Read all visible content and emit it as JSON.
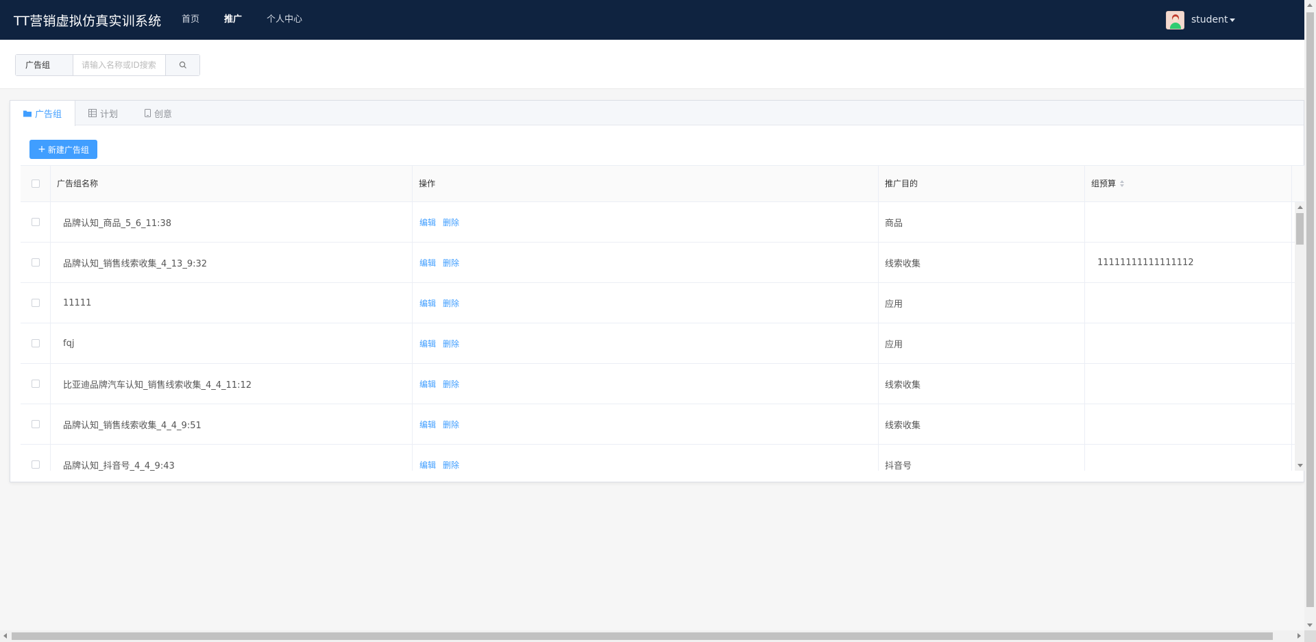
{
  "app": {
    "title": "TT营销虚拟仿真实训系统",
    "nav": [
      {
        "label": "首页",
        "active": false
      },
      {
        "label": "推广",
        "active": true
      },
      {
        "label": "个人中心",
        "active": false
      }
    ],
    "user": {
      "name": "student",
      "avatar_icon": "user-avatar-icon"
    }
  },
  "search": {
    "scope": "广告组",
    "placeholder": "请输入名称或ID搜索",
    "value": "",
    "button_icon": "search-icon"
  },
  "tabs": [
    {
      "label": "广告组",
      "icon": "folder-icon",
      "active": true
    },
    {
      "label": "计划",
      "icon": "table-icon",
      "active": false
    },
    {
      "label": "创意",
      "icon": "mobile-icon",
      "active": false
    }
  ],
  "toolbar": {
    "new_label": "新建广告组"
  },
  "table": {
    "columns": [
      "广告组名称",
      "操作",
      "推广目的",
      "组预算"
    ],
    "actions": {
      "edit": "编辑",
      "delete": "删除"
    },
    "rows": [
      {
        "name": "品牌认知_商品_5_6_11:38",
        "purpose": "商品",
        "budget": ""
      },
      {
        "name": "品牌认知_销售线索收集_4_13_9:32",
        "purpose": "线索收集",
        "budget": "11111111111111112"
      },
      {
        "name": "11111",
        "purpose": "应用",
        "budget": ""
      },
      {
        "name": "fqj",
        "purpose": "应用",
        "budget": ""
      },
      {
        "name": "比亚迪品牌汽车认知_销售线索收集_4_4_11:12",
        "purpose": "线索收集",
        "budget": ""
      },
      {
        "name": "品牌认知_销售线索收集_4_4_9:51",
        "purpose": "线索收集",
        "budget": ""
      },
      {
        "name": "品牌认知_抖音号_4_4_9:43",
        "purpose": "抖音号",
        "budget": ""
      }
    ]
  },
  "colors": {
    "header_bg": "#0f2340",
    "accent": "#409eff",
    "page_bg": "#f6f6f6"
  }
}
